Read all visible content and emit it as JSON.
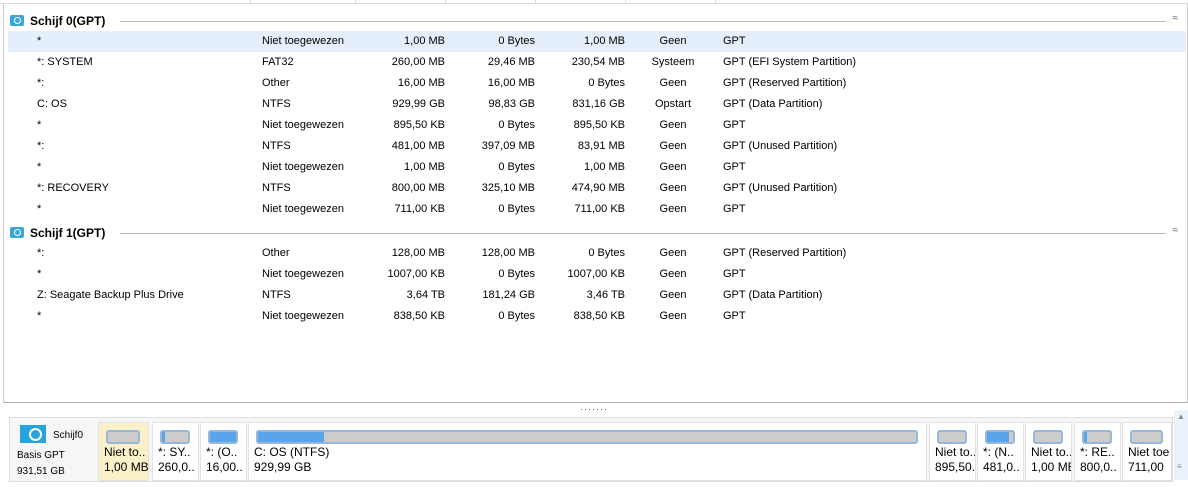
{
  "disks": [
    {
      "title": "Schijf 0(GPT)",
      "rows": [
        [
          "*",
          "Niet toegewezen",
          "1,00 MB",
          "0 Bytes",
          "1,00 MB",
          "Geen",
          "GPT"
        ],
        [
          "*: SYSTEM",
          "FAT32",
          "260,00 MB",
          "29,46 MB",
          "230,54 MB",
          "Systeem",
          "GPT (EFI System Partition)"
        ],
        [
          "*:",
          "Other",
          "16,00 MB",
          "16,00 MB",
          "0 Bytes",
          "Geen",
          "GPT (Reserved Partition)"
        ],
        [
          "C: OS",
          "NTFS",
          "929,99 GB",
          "98,83 GB",
          "831,16 GB",
          "Opstart",
          "GPT (Data Partition)"
        ],
        [
          "*",
          "Niet toegewezen",
          "895,50 KB",
          "0 Bytes",
          "895,50 KB",
          "Geen",
          "GPT"
        ],
        [
          "*:",
          "NTFS",
          "481,00 MB",
          "397,09 MB",
          "83,91 MB",
          "Geen",
          "GPT (Unused Partition)"
        ],
        [
          "*",
          "Niet toegewezen",
          "1,00 MB",
          "0 Bytes",
          "1,00 MB",
          "Geen",
          "GPT"
        ],
        [
          "*: RECOVERY",
          "NTFS",
          "800,00 MB",
          "325,10 MB",
          "474,90 MB",
          "Geen",
          "GPT (Unused Partition)"
        ],
        [
          "*",
          "Niet toegewezen",
          "711,00 KB",
          "0 Bytes",
          "711,00 KB",
          "Geen",
          "GPT"
        ]
      ]
    },
    {
      "title": "Schijf 1(GPT)",
      "rows": [
        [
          "*:",
          "Other",
          "128,00 MB",
          "128,00 MB",
          "0 Bytes",
          "Geen",
          "GPT (Reserved Partition)"
        ],
        [
          "*",
          "Niet toegewezen",
          "1007,00 KB",
          "0 Bytes",
          "1007,00 KB",
          "Geen",
          "GPT"
        ],
        [
          "Z: Seagate Backup Plus Drive",
          "NTFS",
          "3,64 TB",
          "181,24 GB",
          "3,46 TB",
          "Geen",
          "GPT (Data Partition)"
        ],
        [
          "*",
          "Niet toegewezen",
          "838,50 KB",
          "0 Bytes",
          "838,50 KB",
          "Geen",
          "GPT"
        ]
      ]
    }
  ],
  "map": {
    "disk_name": "Schijf0",
    "disk_type": "Basis GPT",
    "disk_size": "931,51 GB",
    "partitions": [
      {
        "l1": "Niet to..",
        "l2": "1,00 MB",
        "used": 0
      },
      {
        "l1": "*: SY..",
        "l2": "260,0..",
        "used": 0.11
      },
      {
        "l1": "*: (O..",
        "l2": "16,00..",
        "used": 1
      },
      {
        "l1": "C: OS (NTFS)",
        "l2": "929,99 GB",
        "used": 0.1
      },
      {
        "l1": "Niet to..",
        "l2": "895,50..",
        "used": 0
      },
      {
        "l1": "*: (N..",
        "l2": "481,0..",
        "used": 0.83
      },
      {
        "l1": "Niet to..",
        "l2": "1,00 MB",
        "used": 0
      },
      {
        "l1": "*: RE..",
        "l2": "800,0..",
        "used": 0.1
      },
      {
        "l1": "Niet toe",
        "l2": "711,00",
        "used": 0
      }
    ]
  }
}
